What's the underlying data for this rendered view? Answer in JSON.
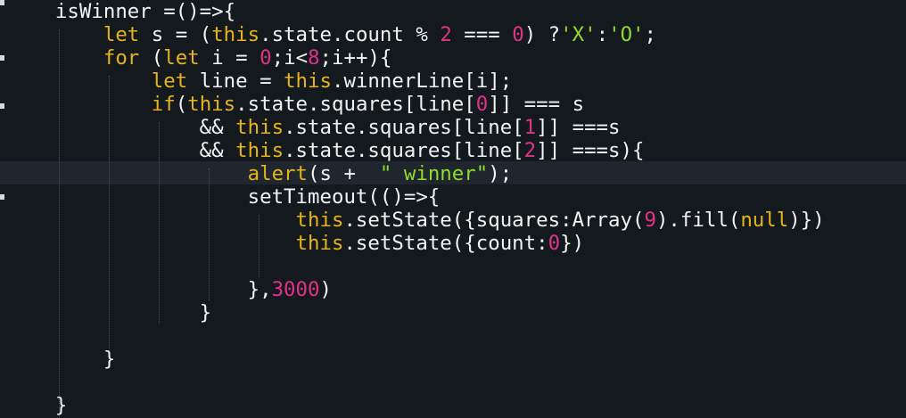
{
  "colors": {
    "background": "#14191e",
    "current_line": "#1f262e",
    "plain": "#f2f2f2",
    "keyword": "#e5b41c",
    "number": "#e0328b",
    "string": "#8fdc2c"
  },
  "code": {
    "lines": [
      [
        {
          "t": "plain",
          "v": "    isWinner =()=>{"
        }
      ],
      [
        {
          "t": "plain",
          "v": "        "
        },
        {
          "t": "kw",
          "v": "let"
        },
        {
          "t": "plain",
          "v": " s = ("
        },
        {
          "t": "kw",
          "v": "this"
        },
        {
          "t": "plain",
          "v": ".state.count % "
        },
        {
          "t": "num",
          "v": "2"
        },
        {
          "t": "plain",
          "v": " === "
        },
        {
          "t": "num",
          "v": "0"
        },
        {
          "t": "plain",
          "v": ") ?"
        },
        {
          "t": "str",
          "v": "'X'"
        },
        {
          "t": "plain",
          "v": ":"
        },
        {
          "t": "str",
          "v": "'O'"
        },
        {
          "t": "plain",
          "v": ";"
        }
      ],
      [
        {
          "t": "plain",
          "v": "        "
        },
        {
          "t": "kw",
          "v": "for"
        },
        {
          "t": "plain",
          "v": " ("
        },
        {
          "t": "kw",
          "v": "let"
        },
        {
          "t": "plain",
          "v": " i = "
        },
        {
          "t": "num",
          "v": "0"
        },
        {
          "t": "plain",
          "v": ";i<"
        },
        {
          "t": "num",
          "v": "8"
        },
        {
          "t": "plain",
          "v": ";i++){"
        }
      ],
      [
        {
          "t": "plain",
          "v": "            "
        },
        {
          "t": "kw",
          "v": "let"
        },
        {
          "t": "plain",
          "v": " line = "
        },
        {
          "t": "kw",
          "v": "this"
        },
        {
          "t": "plain",
          "v": ".winnerLine[i];"
        }
      ],
      [
        {
          "t": "plain",
          "v": "            "
        },
        {
          "t": "kw",
          "v": "if"
        },
        {
          "t": "plain",
          "v": "("
        },
        {
          "t": "kw",
          "v": "this"
        },
        {
          "t": "plain",
          "v": ".state.squares[line["
        },
        {
          "t": "num",
          "v": "0"
        },
        {
          "t": "plain",
          "v": "]] === s"
        }
      ],
      [
        {
          "t": "plain",
          "v": "                && "
        },
        {
          "t": "kw",
          "v": "this"
        },
        {
          "t": "plain",
          "v": ".state.squares[line["
        },
        {
          "t": "num",
          "v": "1"
        },
        {
          "t": "plain",
          "v": "]] ===s"
        }
      ],
      [
        {
          "t": "plain",
          "v": "                && "
        },
        {
          "t": "kw",
          "v": "this"
        },
        {
          "t": "plain",
          "v": ".state.squares[line["
        },
        {
          "t": "num",
          "v": "2"
        },
        {
          "t": "plain",
          "v": "]] ===s){"
        }
      ],
      [
        {
          "t": "plain",
          "v": "                    "
        },
        {
          "t": "kw",
          "v": "alert"
        },
        {
          "t": "plain",
          "v": "(s +  "
        },
        {
          "t": "str",
          "v": "\" winner\""
        },
        {
          "t": "plain",
          "v": ");"
        }
      ],
      [
        {
          "t": "plain",
          "v": "                    setTimeout(()=>{"
        }
      ],
      [
        {
          "t": "plain",
          "v": "                        "
        },
        {
          "t": "kw",
          "v": "this"
        },
        {
          "t": "plain",
          "v": ".setState({squares:Array("
        },
        {
          "t": "num",
          "v": "9"
        },
        {
          "t": "plain",
          "v": ").fill("
        },
        {
          "t": "kw",
          "v": "null"
        },
        {
          "t": "plain",
          "v": ")})"
        }
      ],
      [
        {
          "t": "plain",
          "v": "                        "
        },
        {
          "t": "kw",
          "v": "this"
        },
        {
          "t": "plain",
          "v": ".setState({count:"
        },
        {
          "t": "num",
          "v": "0"
        },
        {
          "t": "plain",
          "v": "})"
        }
      ],
      [
        {
          "t": "plain",
          "v": ""
        }
      ],
      [
        {
          "t": "plain",
          "v": "                    },"
        },
        {
          "t": "num",
          "v": "3000"
        },
        {
          "t": "plain",
          "v": ")"
        }
      ],
      [
        {
          "t": "plain",
          "v": "                }"
        }
      ],
      [
        {
          "t": "plain",
          "v": ""
        }
      ],
      [
        {
          "t": "plain",
          "v": "        }"
        }
      ],
      [
        {
          "t": "plain",
          "v": ""
        }
      ],
      [
        {
          "t": "plain",
          "v": "    }"
        }
      ]
    ]
  }
}
